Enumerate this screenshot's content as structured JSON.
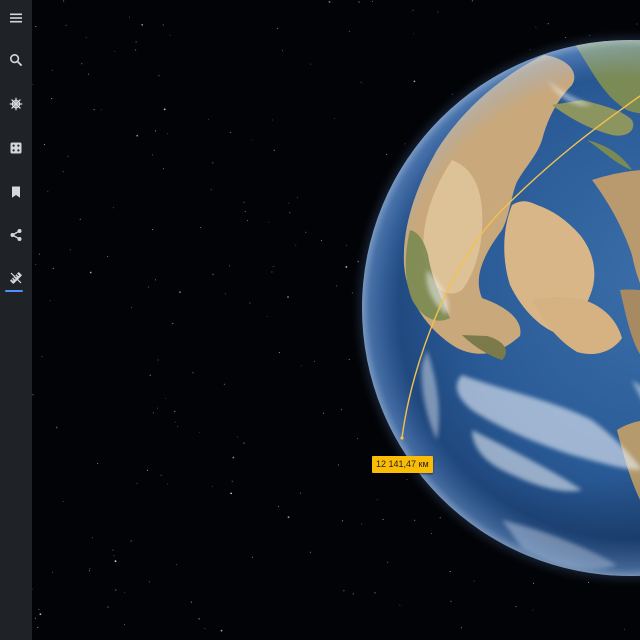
{
  "sidebar": {
    "items": [
      {
        "name": "menu",
        "icon": "menu-icon",
        "active": false
      },
      {
        "name": "search",
        "icon": "search-icon",
        "active": false
      },
      {
        "name": "voyager",
        "icon": "voyager-helm-icon",
        "active": false
      },
      {
        "name": "feeling-lucky",
        "icon": "dice-icon",
        "active": false
      },
      {
        "name": "projects",
        "icon": "bookmark-icon",
        "active": false
      },
      {
        "name": "share",
        "icon": "share-icon",
        "active": false
      },
      {
        "name": "measure",
        "icon": "ruler-icon",
        "active": true
      }
    ],
    "active_indicator_color": "#4d90fe"
  },
  "map": {
    "measurement_label": "12 141,47 км",
    "measurement_line_color": "#f2c14e",
    "label_color": "#fbbc05"
  }
}
